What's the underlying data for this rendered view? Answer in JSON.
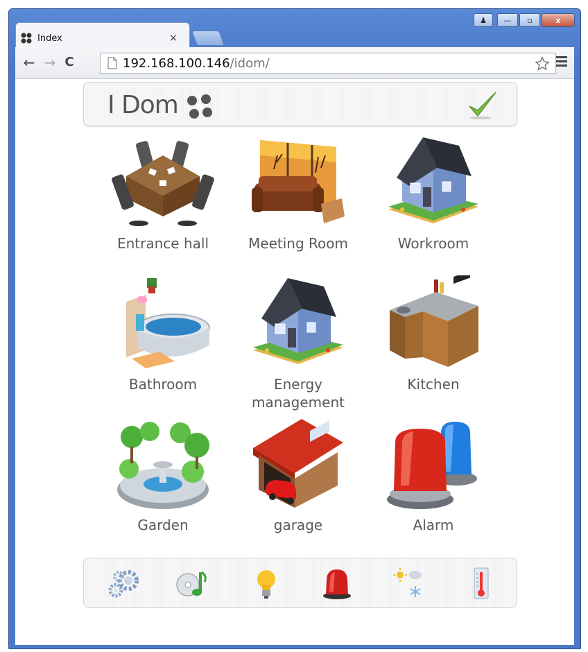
{
  "browser": {
    "tab_title": "Index",
    "tab_close": "×",
    "url_host": "192.168.100.146",
    "url_path": "/idom/",
    "controls": {
      "user": "♟",
      "minimize": "—",
      "maximize": "▫",
      "close": "x"
    }
  },
  "header": {
    "logo_text": "I Dom"
  },
  "rooms": [
    {
      "label": "Entrance hall",
      "icon": "dining-table-icon"
    },
    {
      "label": "Meeting Room",
      "icon": "sofa-window-icon"
    },
    {
      "label": "Workroom",
      "icon": "house-icon"
    },
    {
      "label": "Bathroom",
      "icon": "bathtub-icon"
    },
    {
      "label": "Energy management",
      "icon": "house-icon"
    },
    {
      "label": "Kitchen",
      "icon": "kitchen-counter-icon"
    },
    {
      "label": "Garden",
      "icon": "garden-fountain-icon"
    },
    {
      "label": "garage",
      "icon": "garage-car-icon"
    },
    {
      "label": "Alarm",
      "icon": "siren-lights-icon"
    }
  ],
  "footer_icons": [
    "gears-icon",
    "music-cd-icon",
    "light-bulb-icon",
    "alarm-light-icon",
    "weather-icon",
    "thermometer-icon"
  ],
  "colors": {
    "window_frame": "#4a79c8",
    "label_text": "#595959",
    "check_green": "#7bc043",
    "alarm_red": "#d8281b",
    "alarm_blue": "#1f7ee0"
  }
}
